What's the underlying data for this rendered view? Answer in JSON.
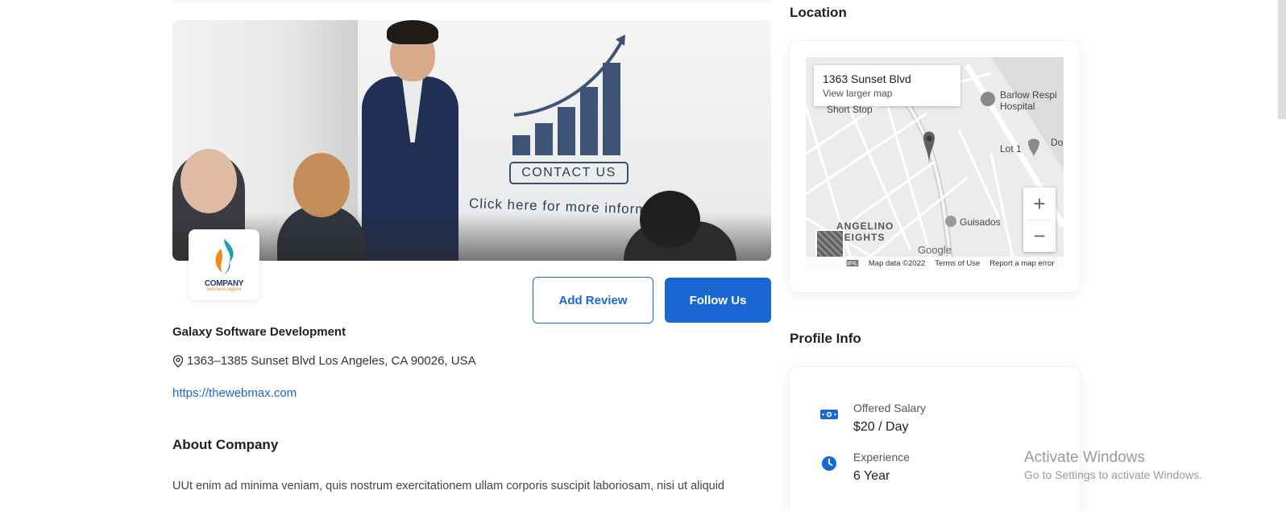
{
  "banner": {
    "contact_text": "CONTACT US",
    "click_text": "Click here for more inform"
  },
  "logo": {
    "word": "COMPANY",
    "tagline": "business tagline"
  },
  "actions": {
    "add_review": "Add Review",
    "follow_us": "Follow Us"
  },
  "company": {
    "name": "Galaxy Software Development",
    "address": "1363–1385 Sunset Blvd Los Angeles, CA 90026, USA",
    "website": "https://thewebmax.com"
  },
  "about": {
    "title": "About Company",
    "text": "UUt enim ad minima veniam, quis nostrum exercitationem ullam corporis suscipit laboriosam, nisi ut aliquid"
  },
  "location": {
    "title": "Location",
    "map": {
      "info_address": "1363 Sunset Blvd",
      "info_link": "View larger map",
      "zoom_in": "+",
      "zoom_out": "−",
      "footer_data": "Map data ©2022",
      "footer_terms": "Terms of Use",
      "footer_report": "Report a map error",
      "labels": {
        "barlow": "Barlow Respi\nHospital",
        "short_stop": "Short Stop",
        "lot": "Lot 1",
        "do": "Do",
        "angelino": "ANGELINO\nHEIGHTS",
        "guisados": "Guisados",
        "google": "Google"
      }
    }
  },
  "profile_info": {
    "title": "Profile Info",
    "items": [
      {
        "label": "Offered Salary",
        "value": "$20 / Day",
        "icon": "money-icon"
      },
      {
        "label": "Experience",
        "value": "6 Year",
        "icon": "clock-icon"
      }
    ]
  },
  "os_watermark": {
    "title": "Activate Windows",
    "subtitle": "Go to Settings to activate Windows."
  },
  "colors": {
    "primary": "#1967d2",
    "text": "#202124"
  }
}
